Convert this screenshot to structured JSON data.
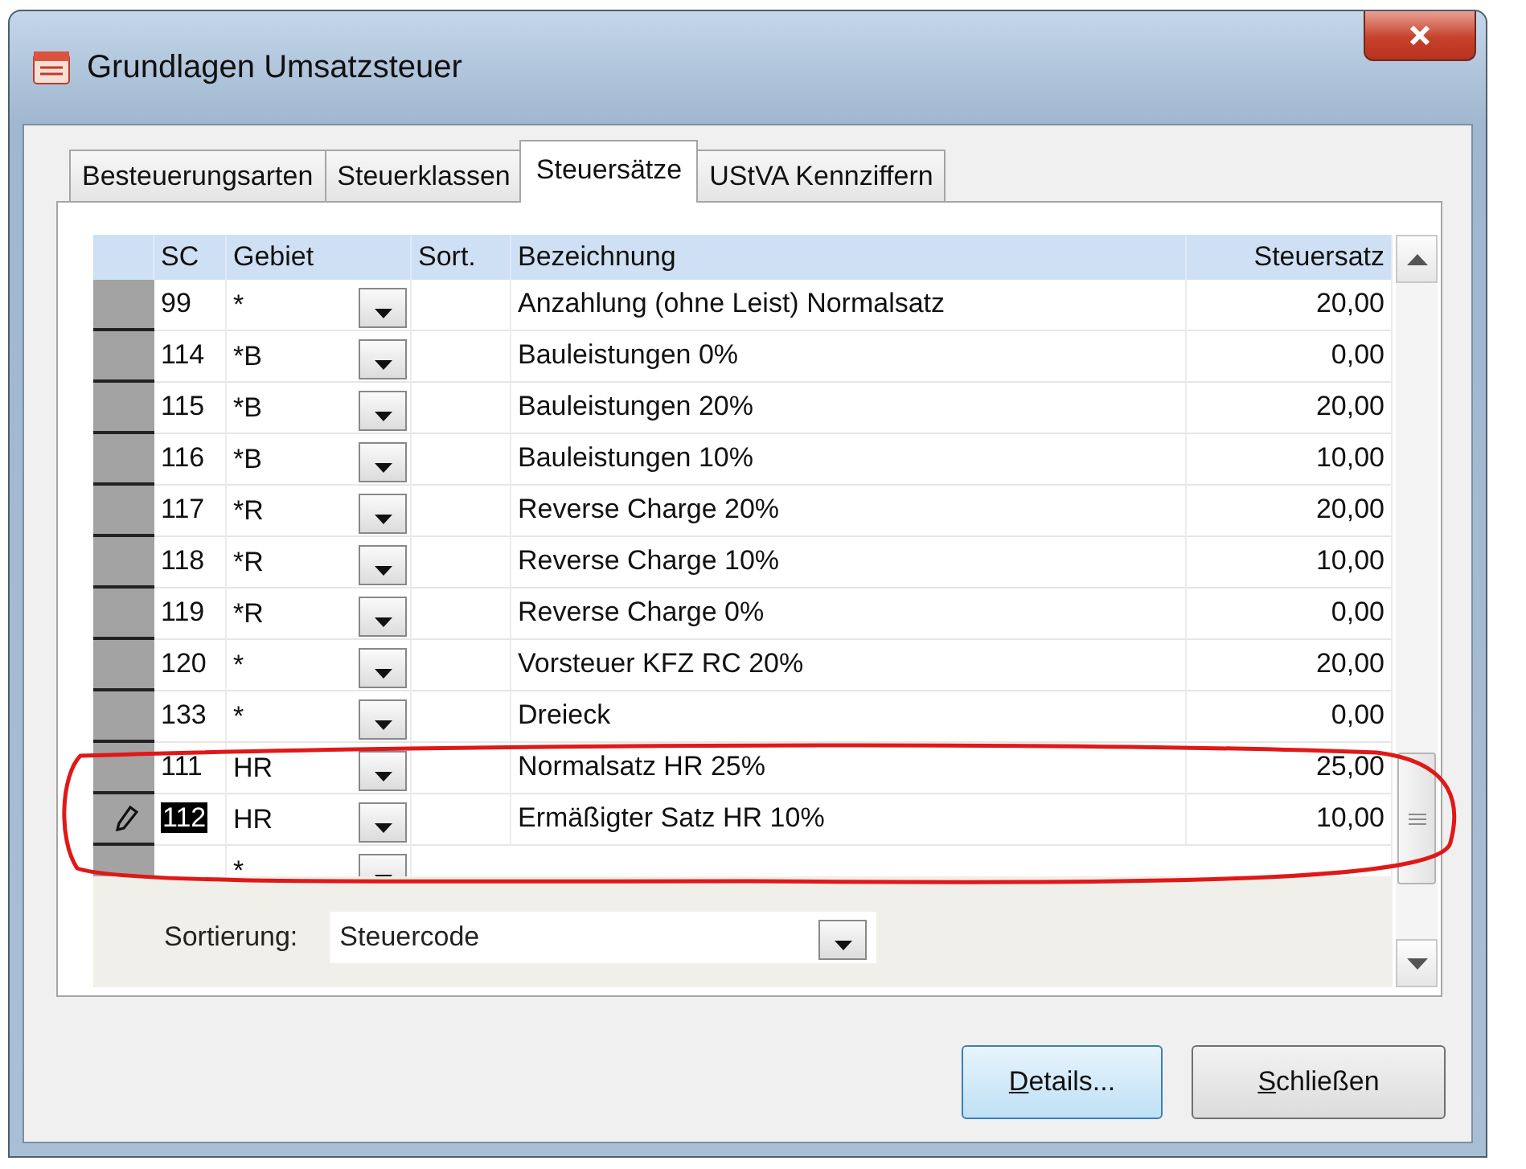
{
  "window": {
    "title": "Grundlagen Umsatzsteuer"
  },
  "tabs": [
    {
      "label": "Besteuerungsarten",
      "selected": false
    },
    {
      "label": "Steuerklassen",
      "selected": false
    },
    {
      "label": "Steuersätze",
      "selected": true
    },
    {
      "label": "UStVA Kennziffern",
      "selected": false
    }
  ],
  "table": {
    "columns": [
      "SC",
      "Gebiet",
      "Sort.",
      "Bezeichnung",
      "Steuersatz"
    ],
    "rows": [
      {
        "kind": "data",
        "sc": "99",
        "gebiet": "*",
        "bezeichnung": "Anzahlung (ohne Leist)  Normalsatz",
        "steuersatz": "20,00",
        "editing": false
      },
      {
        "kind": "data",
        "sc": "114",
        "gebiet": "*B",
        "bezeichnung": "Bauleistungen 0%",
        "steuersatz": "0,00",
        "editing": false
      },
      {
        "kind": "data",
        "sc": "115",
        "gebiet": "*B",
        "bezeichnung": "Bauleistungen 20%",
        "steuersatz": "20,00",
        "editing": false
      },
      {
        "kind": "data",
        "sc": "116",
        "gebiet": "*B",
        "bezeichnung": "Bauleistungen 10%",
        "steuersatz": "10,00",
        "editing": false
      },
      {
        "kind": "data",
        "sc": "117",
        "gebiet": "*R",
        "bezeichnung": "Reverse Charge 20%",
        "steuersatz": "20,00",
        "editing": false
      },
      {
        "kind": "data",
        "sc": "118",
        "gebiet": "*R",
        "bezeichnung": "Reverse Charge 10%",
        "steuersatz": "10,00",
        "editing": false
      },
      {
        "kind": "data",
        "sc": "119",
        "gebiet": "*R",
        "bezeichnung": "Reverse Charge 0%",
        "steuersatz": "0,00",
        "editing": false
      },
      {
        "kind": "data",
        "sc": "120",
        "gebiet": "*",
        "bezeichnung": "Vorsteuer KFZ RC 20%",
        "steuersatz": "20,00",
        "editing": false
      },
      {
        "kind": "data",
        "sc": "133",
        "gebiet": "*",
        "bezeichnung": "Dreieck",
        "steuersatz": "0,00",
        "editing": false
      },
      {
        "kind": "data",
        "sc": "111",
        "gebiet": "HR",
        "bezeichnung": "Normalsatz HR 25%",
        "steuersatz": "25,00",
        "editing": false
      },
      {
        "kind": "data",
        "sc": "112",
        "gebiet": "HR",
        "bezeichnung": "Ermäßigter Satz HR 10%",
        "steuersatz": "10,00",
        "editing": true
      },
      {
        "kind": "new",
        "gebiet": "*"
      }
    ]
  },
  "sort_field": {
    "label": "Sortierung:",
    "value": "Steuercode"
  },
  "buttons": [
    {
      "label": "Details...",
      "default": true
    },
    {
      "label": "Schließen",
      "default": false
    }
  ]
}
